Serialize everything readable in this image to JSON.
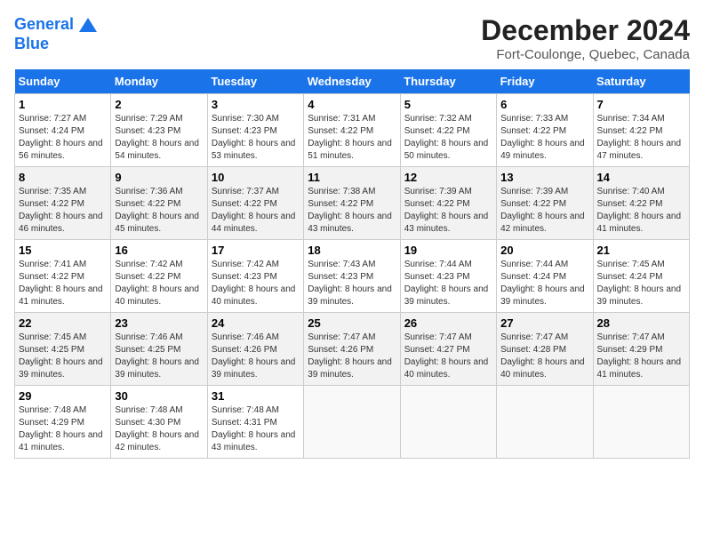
{
  "logo": {
    "line1": "General",
    "line2": "Blue"
  },
  "title": "December 2024",
  "location": "Fort-Coulonge, Quebec, Canada",
  "days_of_week": [
    "Sunday",
    "Monday",
    "Tuesday",
    "Wednesday",
    "Thursday",
    "Friday",
    "Saturday"
  ],
  "weeks": [
    [
      {
        "num": "1",
        "sunrise": "7:27 AM",
        "sunset": "4:24 PM",
        "daylight": "8 hours and 56 minutes."
      },
      {
        "num": "2",
        "sunrise": "7:29 AM",
        "sunset": "4:23 PM",
        "daylight": "8 hours and 54 minutes."
      },
      {
        "num": "3",
        "sunrise": "7:30 AM",
        "sunset": "4:23 PM",
        "daylight": "8 hours and 53 minutes."
      },
      {
        "num": "4",
        "sunrise": "7:31 AM",
        "sunset": "4:22 PM",
        "daylight": "8 hours and 51 minutes."
      },
      {
        "num": "5",
        "sunrise": "7:32 AM",
        "sunset": "4:22 PM",
        "daylight": "8 hours and 50 minutes."
      },
      {
        "num": "6",
        "sunrise": "7:33 AM",
        "sunset": "4:22 PM",
        "daylight": "8 hours and 49 minutes."
      },
      {
        "num": "7",
        "sunrise": "7:34 AM",
        "sunset": "4:22 PM",
        "daylight": "8 hours and 47 minutes."
      }
    ],
    [
      {
        "num": "8",
        "sunrise": "7:35 AM",
        "sunset": "4:22 PM",
        "daylight": "8 hours and 46 minutes."
      },
      {
        "num": "9",
        "sunrise": "7:36 AM",
        "sunset": "4:22 PM",
        "daylight": "8 hours and 45 minutes."
      },
      {
        "num": "10",
        "sunrise": "7:37 AM",
        "sunset": "4:22 PM",
        "daylight": "8 hours and 44 minutes."
      },
      {
        "num": "11",
        "sunrise": "7:38 AM",
        "sunset": "4:22 PM",
        "daylight": "8 hours and 43 minutes."
      },
      {
        "num": "12",
        "sunrise": "7:39 AM",
        "sunset": "4:22 PM",
        "daylight": "8 hours and 43 minutes."
      },
      {
        "num": "13",
        "sunrise": "7:39 AM",
        "sunset": "4:22 PM",
        "daylight": "8 hours and 42 minutes."
      },
      {
        "num": "14",
        "sunrise": "7:40 AM",
        "sunset": "4:22 PM",
        "daylight": "8 hours and 41 minutes."
      }
    ],
    [
      {
        "num": "15",
        "sunrise": "7:41 AM",
        "sunset": "4:22 PM",
        "daylight": "8 hours and 41 minutes."
      },
      {
        "num": "16",
        "sunrise": "7:42 AM",
        "sunset": "4:22 PM",
        "daylight": "8 hours and 40 minutes."
      },
      {
        "num": "17",
        "sunrise": "7:42 AM",
        "sunset": "4:23 PM",
        "daylight": "8 hours and 40 minutes."
      },
      {
        "num": "18",
        "sunrise": "7:43 AM",
        "sunset": "4:23 PM",
        "daylight": "8 hours and 39 minutes."
      },
      {
        "num": "19",
        "sunrise": "7:44 AM",
        "sunset": "4:23 PM",
        "daylight": "8 hours and 39 minutes."
      },
      {
        "num": "20",
        "sunrise": "7:44 AM",
        "sunset": "4:24 PM",
        "daylight": "8 hours and 39 minutes."
      },
      {
        "num": "21",
        "sunrise": "7:45 AM",
        "sunset": "4:24 PM",
        "daylight": "8 hours and 39 minutes."
      }
    ],
    [
      {
        "num": "22",
        "sunrise": "7:45 AM",
        "sunset": "4:25 PM",
        "daylight": "8 hours and 39 minutes."
      },
      {
        "num": "23",
        "sunrise": "7:46 AM",
        "sunset": "4:25 PM",
        "daylight": "8 hours and 39 minutes."
      },
      {
        "num": "24",
        "sunrise": "7:46 AM",
        "sunset": "4:26 PM",
        "daylight": "8 hours and 39 minutes."
      },
      {
        "num": "25",
        "sunrise": "7:47 AM",
        "sunset": "4:26 PM",
        "daylight": "8 hours and 39 minutes."
      },
      {
        "num": "26",
        "sunrise": "7:47 AM",
        "sunset": "4:27 PM",
        "daylight": "8 hours and 40 minutes."
      },
      {
        "num": "27",
        "sunrise": "7:47 AM",
        "sunset": "4:28 PM",
        "daylight": "8 hours and 40 minutes."
      },
      {
        "num": "28",
        "sunrise": "7:47 AM",
        "sunset": "4:29 PM",
        "daylight": "8 hours and 41 minutes."
      }
    ],
    [
      {
        "num": "29",
        "sunrise": "7:48 AM",
        "sunset": "4:29 PM",
        "daylight": "8 hours and 41 minutes."
      },
      {
        "num": "30",
        "sunrise": "7:48 AM",
        "sunset": "4:30 PM",
        "daylight": "8 hours and 42 minutes."
      },
      {
        "num": "31",
        "sunrise": "7:48 AM",
        "sunset": "4:31 PM",
        "daylight": "8 hours and 43 minutes."
      },
      null,
      null,
      null,
      null
    ]
  ],
  "labels": {
    "sunrise": "Sunrise:",
    "sunset": "Sunset:",
    "daylight": "Daylight:"
  }
}
